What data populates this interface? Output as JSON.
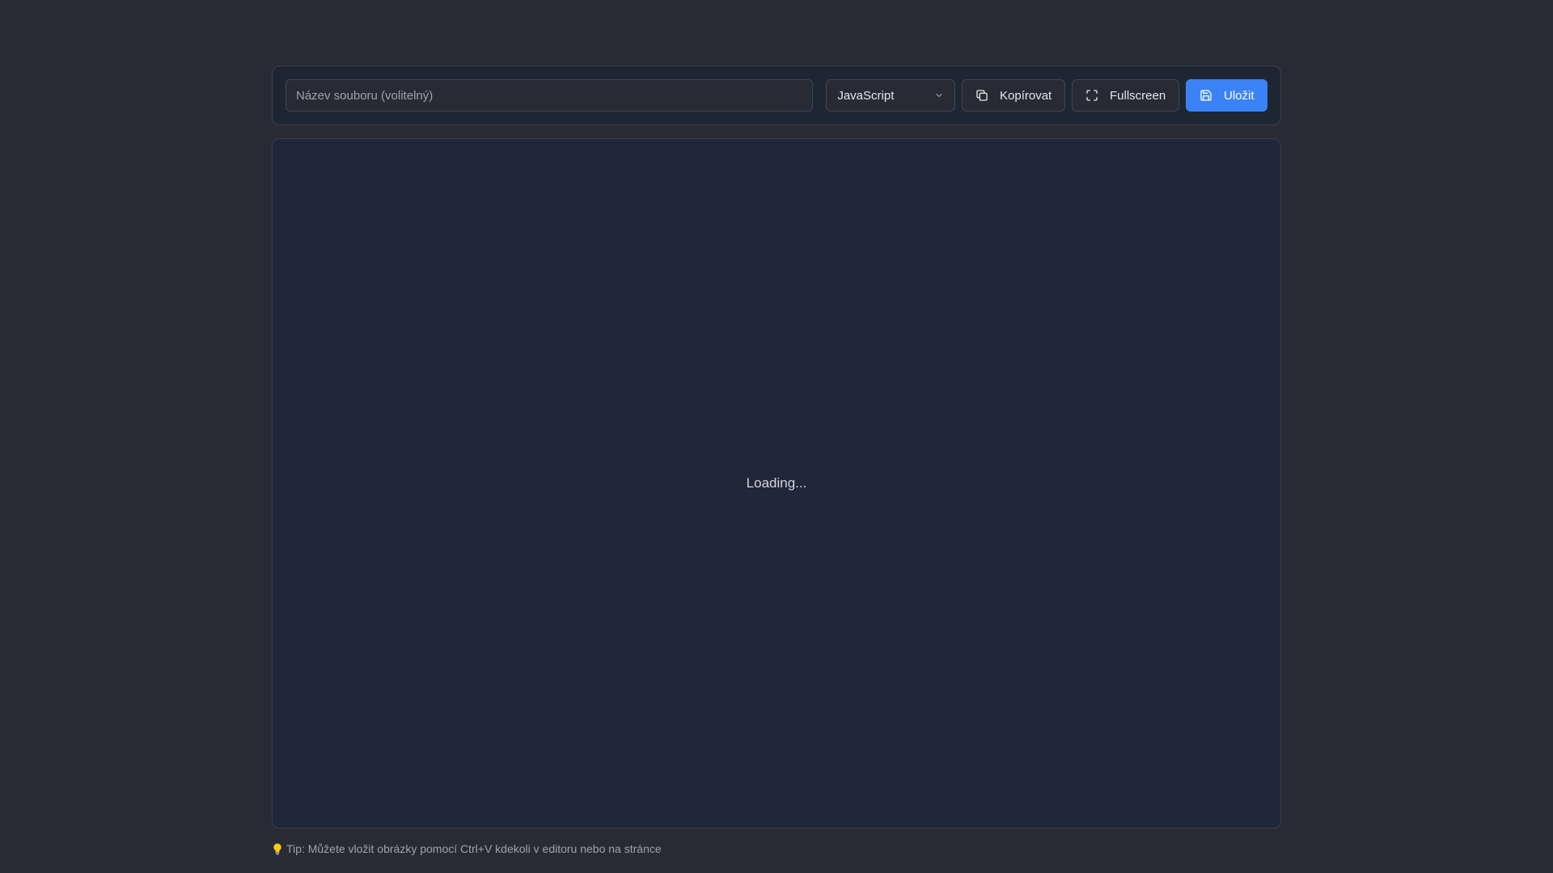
{
  "toolbar": {
    "filename_placeholder": "Název souboru (volitelný)",
    "filename_value": "",
    "language_selected": "JavaScript",
    "copy_label": "Kopírovat",
    "fullscreen_label": "Fullscreen",
    "save_label": "Uložit"
  },
  "editor": {
    "status_text": "Loading..."
  },
  "footer": {
    "tip_text": "Tip: Můžete vložit obrázky pomocí Ctrl+V kdekoli v editoru nebo na stránce"
  },
  "icons": {
    "select": "chevron-down-icon",
    "copy": "copy-icon",
    "fullscreen": "fullscreen-icon",
    "save": "save-icon",
    "tip": "lightbulb-icon"
  },
  "colors": {
    "background": "#282b33",
    "panel": "#1f2633",
    "editor": "#1f2738",
    "accent": "#3b82f6",
    "border": "#374151"
  }
}
